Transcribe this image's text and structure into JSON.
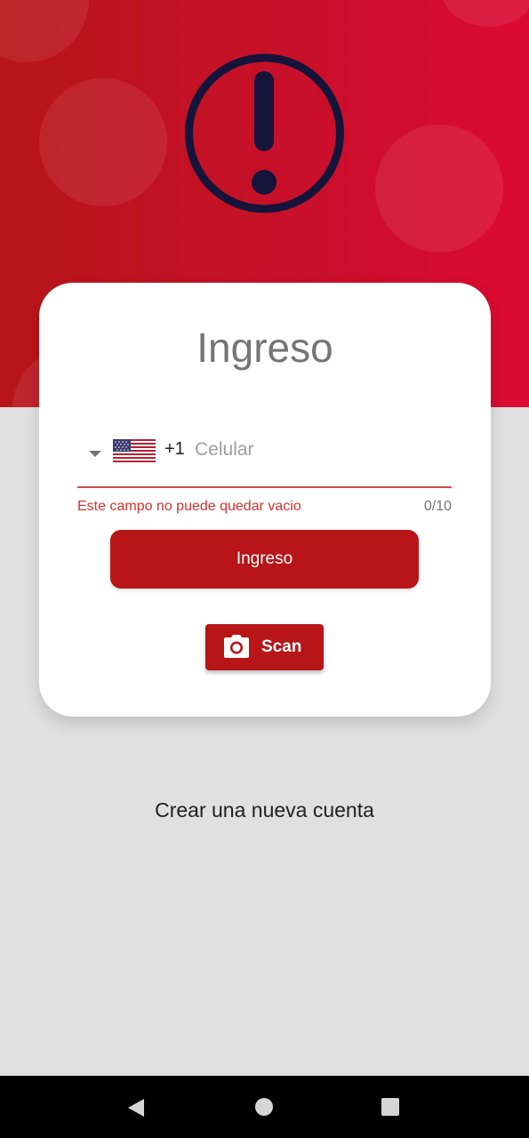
{
  "colors": {
    "brand_red": "#b71518",
    "error_red": "#d32f2f",
    "alert_icon": "#15143a"
  },
  "header": {
    "icon": "alert-exclamation-icon"
  },
  "card": {
    "title": "Ingreso",
    "phone": {
      "country_code": "+1",
      "flag_icon": "us-flag-icon",
      "placeholder": "Celular",
      "value": "",
      "error": "Este campo no puede quedar vacio",
      "counter": "0/10"
    },
    "login_button": "Ingreso",
    "scan_button": {
      "label": "Scan",
      "icon": "camera-icon"
    }
  },
  "create_account_link": "Crear una nueva cuenta",
  "navbar": {
    "icons": [
      "back-triangle-icon",
      "home-circle-icon",
      "recents-square-icon"
    ]
  }
}
